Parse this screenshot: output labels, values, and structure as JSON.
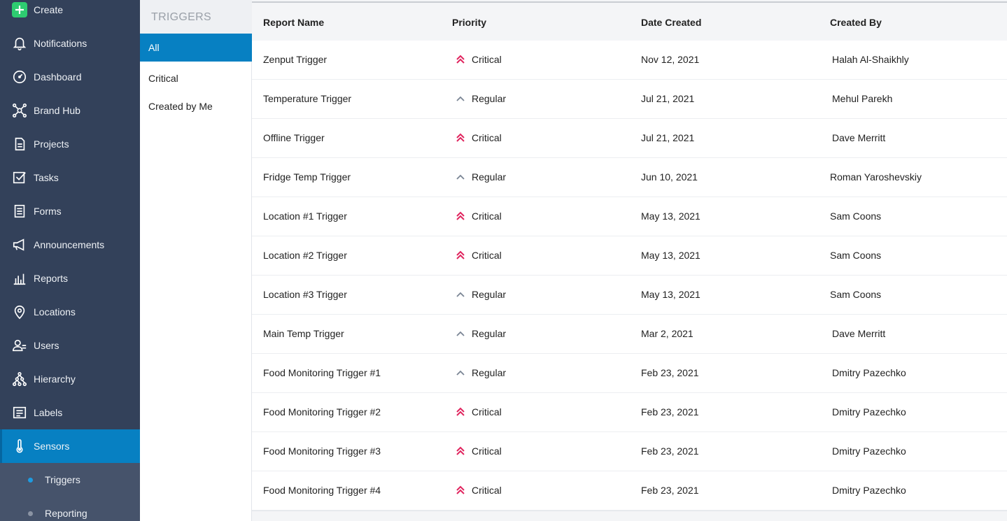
{
  "sidebar": {
    "items": [
      {
        "label": "Create",
        "icon": "plus-square-icon"
      },
      {
        "label": "Notifications",
        "icon": "bell-icon"
      },
      {
        "label": "Dashboard",
        "icon": "gauge-icon"
      },
      {
        "label": "Brand Hub",
        "icon": "hub-icon"
      },
      {
        "label": "Projects",
        "icon": "document-icon"
      },
      {
        "label": "Tasks",
        "icon": "checkbox-icon"
      },
      {
        "label": "Forms",
        "icon": "form-icon"
      },
      {
        "label": "Announcements",
        "icon": "megaphone-icon"
      },
      {
        "label": "Reports",
        "icon": "bar-chart-icon"
      },
      {
        "label": "Locations",
        "icon": "map-pin-icon"
      },
      {
        "label": "Users",
        "icon": "users-icon"
      },
      {
        "label": "Hierarchy",
        "icon": "hierarchy-icon"
      },
      {
        "label": "Labels",
        "icon": "label-icon"
      },
      {
        "label": "Sensors",
        "icon": "thermometer-icon"
      }
    ],
    "subitems": [
      {
        "label": "Triggers",
        "dot_color": "#1e9be0"
      },
      {
        "label": "Reporting",
        "dot_color": "#8a93a3"
      }
    ],
    "accent": "#0780c2",
    "background": "#33415a",
    "create_icon_color": "#2ecc71"
  },
  "filter_panel": {
    "title": "TRIGGERS",
    "items": [
      {
        "label": "All"
      },
      {
        "label": "Critical"
      },
      {
        "label": "Created by Me"
      }
    ]
  },
  "table": {
    "columns": [
      "Report Name",
      "Priority",
      "Date Created",
      "Created By"
    ],
    "rows": [
      {
        "name": "Zenput Trigger",
        "priority": "Critical",
        "date": "Nov 12, 2021",
        "by": "Halah Al-Shaikhly"
      },
      {
        "name": "Temperature Trigger",
        "priority": "Regular",
        "date": "Jul 21, 2021",
        "by": "Mehul Parekh"
      },
      {
        "name": "Offline Trigger",
        "priority": "Critical",
        "date": "Jul 21, 2021",
        "by": "Dave Merritt"
      },
      {
        "name": "Fridge Temp Trigger",
        "priority": "Regular",
        "date": "Jun 10, 2021",
        "by": "Roman Yaroshevskiy"
      },
      {
        "name": "Location #1 Trigger",
        "priority": "Critical",
        "date": "May 13, 2021",
        "by": "Sam Coons"
      },
      {
        "name": "Location #2 Trigger",
        "priority": "Critical",
        "date": "May 13, 2021",
        "by": "Sam Coons"
      },
      {
        "name": "Location #3 Trigger",
        "priority": "Regular",
        "date": "May 13, 2021",
        "by": "Sam Coons"
      },
      {
        "name": "Main Temp Trigger",
        "priority": "Regular",
        "date": "Mar 2, 2021",
        "by": "Dave Merritt"
      },
      {
        "name": "Food Monitoring Trigger #1",
        "priority": "Regular",
        "date": "Feb 23, 2021",
        "by": "Dmitry Pazechko"
      },
      {
        "name": "Food Monitoring Trigger #2",
        "priority": "Critical",
        "date": "Feb 23, 2021",
        "by": "Dmitry Pazechko"
      },
      {
        "name": "Food Monitoring Trigger #3",
        "priority": "Critical",
        "date": "Feb 23, 2021",
        "by": "Dmitry Pazechko"
      },
      {
        "name": "Food Monitoring Trigger #4",
        "priority": "Critical",
        "date": "Feb 23, 2021",
        "by": "Dmitry Pazechko"
      }
    ],
    "priority_colors": {
      "Critical": "#e0245e",
      "Regular": "#7a8594"
    }
  }
}
